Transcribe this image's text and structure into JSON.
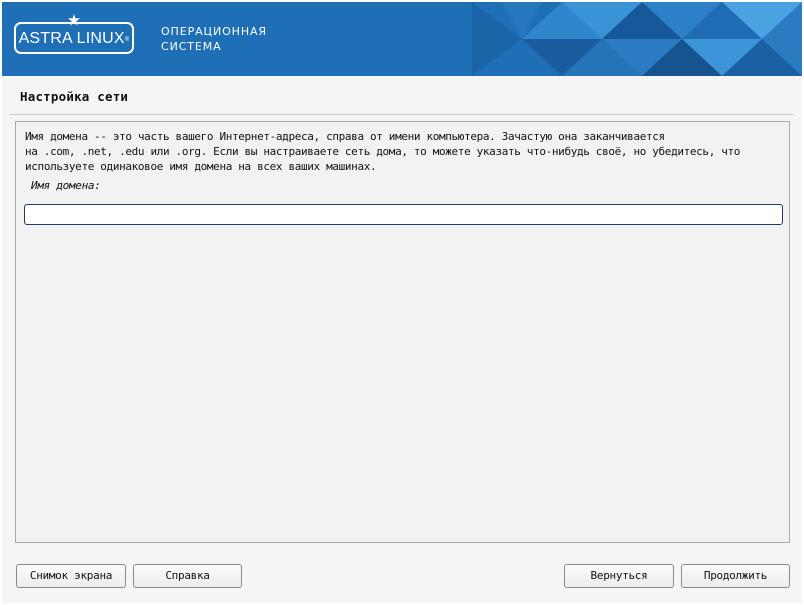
{
  "header": {
    "logo_text": "ASTRA LINUX",
    "logo_mark": "®",
    "subtitle_line1": "ОПЕРАЦИОННАЯ",
    "subtitle_line2": "СИСТЕМА",
    "banner_color": "#1f6fb7"
  },
  "page": {
    "title": "Настройка сети"
  },
  "content": {
    "description_lines": [
      "Имя домена -- это часть вашего Интернет-адреса, справа от имени компьютера. Зачастую она заканчивается",
      "на .com, .net, .edu или .org. Если вы настраиваете сеть дома, то можете указать что-нибудь своё, но убедитесь, что",
      "используете одинаковое имя домена на всех ваших машинах."
    ],
    "field_label": "Имя домена:",
    "domain_value": ""
  },
  "buttons": {
    "screenshot": "Снимок экрана",
    "help": "Справка",
    "back": "Вернуться",
    "continue": "Продолжить"
  }
}
